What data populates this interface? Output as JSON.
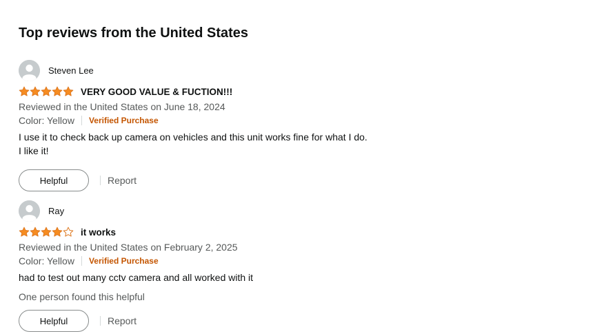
{
  "section": {
    "title": "Top reviews from the United States"
  },
  "colors": {
    "star": "#f68c21",
    "star_stroke": "#de7921",
    "verified": "#c45500",
    "secondary_text": "#565959"
  },
  "reviews": [
    {
      "profile_name": "Steven Lee",
      "rating": 5,
      "rating_max": 5,
      "title": "VERY GOOD VALUE & FUCTION!!!",
      "date": "Reviewed in the United States on June 18, 2024",
      "format": "Color: Yellow",
      "verified": "Verified Purchase",
      "body": [
        "I use it to check back up camera on vehicles and this unit works fine for what I do.",
        "I like it!"
      ],
      "helpful_label": "Helpful",
      "report_label": "Report"
    },
    {
      "profile_name": "Ray",
      "rating": 4,
      "rating_max": 5,
      "title": "it works",
      "date": "Reviewed in the United States on February 2, 2025",
      "format": "Color: Yellow",
      "verified": "Verified Purchase",
      "body": [
        "had to test out many cctv camera and all worked with it"
      ],
      "helpful_count": "One person found this helpful",
      "helpful_label": "Helpful",
      "report_label": "Report"
    }
  ]
}
